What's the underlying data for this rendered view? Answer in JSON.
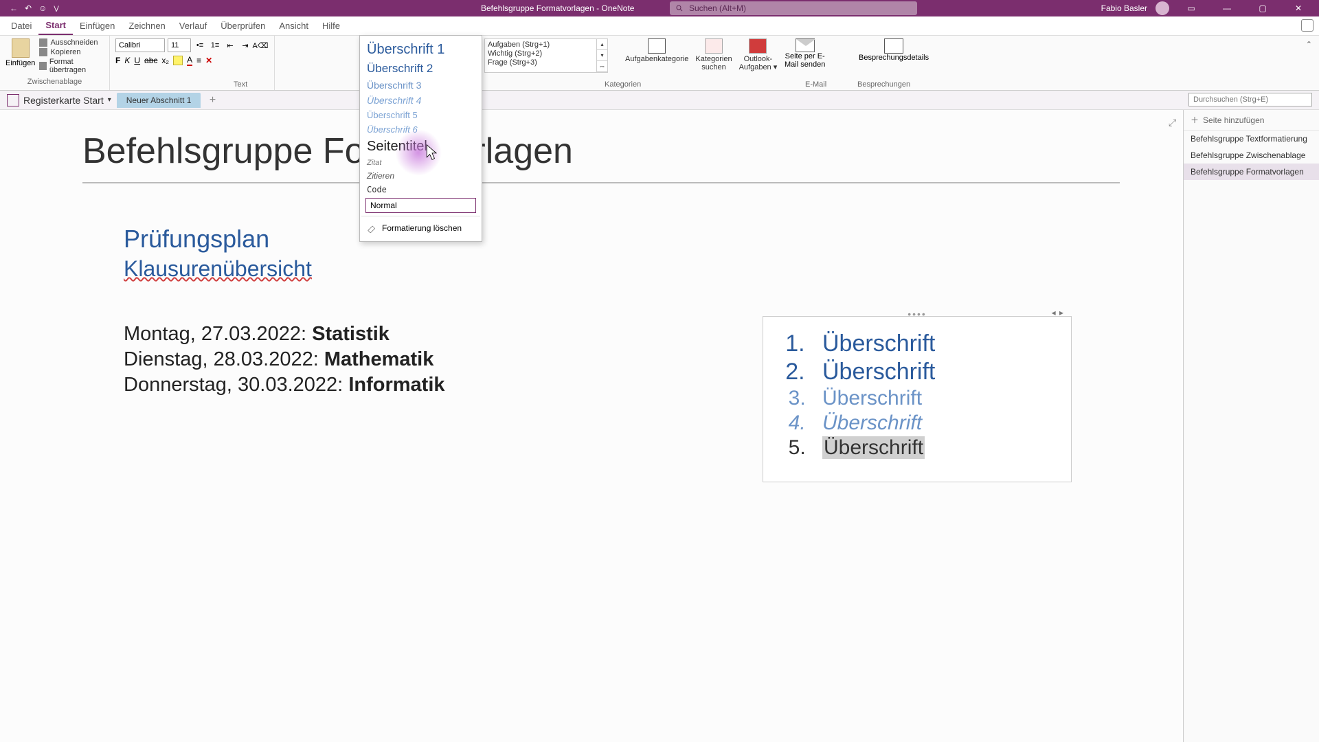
{
  "titlebar": {
    "doc_title": "Befehlsgruppe Formatvorlagen  -  OneNote",
    "search_placeholder": "Suchen (Alt+M)",
    "user_name": "Fabio Basler"
  },
  "menu": {
    "items": [
      "Datei",
      "Start",
      "Einfügen",
      "Zeichnen",
      "Verlauf",
      "Überprüfen",
      "Ansicht",
      "Hilfe"
    ],
    "active_index": 1
  },
  "ribbon": {
    "clipboard": {
      "paste": "Einfügen",
      "cut": "Ausschneiden",
      "copy": "Kopieren",
      "format_painter": "Format übertragen",
      "group_label": "Zwischenablage"
    },
    "text": {
      "font_name": "Calibri",
      "font_size": "11",
      "group_label": "Text"
    },
    "styles_gallery": {
      "h1": "Überschrift 1",
      "h2": "Überschrift 2",
      "h3": "Überschrift 3",
      "h4": "Überschrift 4",
      "h5": "Überschrift 5",
      "h6": "Überschrift 6",
      "page_title": "Seitentitel",
      "zitat": "Zitat",
      "zitieren": "Zitieren",
      "code": "Code",
      "normal": "Normal",
      "clear_formatting": "Formatierung löschen"
    },
    "tags": {
      "t1": "Aufgaben (Strg+1)",
      "t2": "Wichtig (Strg+2)",
      "t3": "Frage (Strg+3)",
      "task_category": "Aufgabenkategorie",
      "find_categories": "Kategorien\nsuchen",
      "outlook_tasks": "Outlook-\nAufgaben ▾",
      "group_label": "Kategorien"
    },
    "email": {
      "label": "Seite per E-\nMail senden",
      "group_label": "E-Mail"
    },
    "meeting": {
      "label": "Besprechungsdetails",
      "group_label": "Besprechungen"
    }
  },
  "tabstrip": {
    "notebook": "Registerkarte Start",
    "section": "Neuer Abschnitt 1",
    "search_placeholder": "Durchsuchen (Strg+E)"
  },
  "page": {
    "title": "Befehlsgruppe Formatvorlagen",
    "content": {
      "heading1": "Prüfungsplan",
      "heading2": "Klausurenübersicht",
      "line1a": "Montag, 27.03.2022: ",
      "line1b": "Statistik",
      "line2a": "Dienstag, 28.03.2022: ",
      "line2b": "Mathematik",
      "line3a": "Donnerstag, 30.03.2022: ",
      "line3b": "Informatik"
    },
    "list_container": {
      "i1": "Überschrift",
      "i2": "Überschrift",
      "i3": "Überschrift",
      "i4": "Überschrift",
      "i5": "Überschrift"
    }
  },
  "pagelist": {
    "add_page": "Seite hinzufügen",
    "items": [
      "Befehlsgruppe Textformatierung",
      "Befehlsgruppe Zwischenablage",
      "Befehlsgruppe Formatvorlagen"
    ],
    "active_index": 2
  }
}
